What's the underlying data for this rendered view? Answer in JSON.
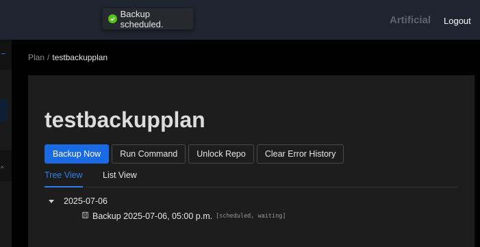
{
  "toast": {
    "icon": "check-circle-icon",
    "message": "Backup scheduled."
  },
  "topbar": {
    "brand": "Artificial",
    "logout_label": "Logout"
  },
  "breadcrumb": {
    "parent": "Plan",
    "separator": "/",
    "current": "testbackupplan"
  },
  "page": {
    "title": "testbackupplan"
  },
  "actions": {
    "backup_now": "Backup Now",
    "run_command": "Run Command",
    "unlock_repo": "Unlock Repo",
    "clear_error_history": "Clear Error History"
  },
  "tabs": [
    {
      "label": "Tree View",
      "active": true
    },
    {
      "label": "List View",
      "active": false
    }
  ],
  "tree": {
    "date": "2025-07-06",
    "items": [
      {
        "icon": "disk-icon",
        "label": "Backup 2025-07-06, 05:00 p.m.",
        "status": "[scheduled, waiting]"
      }
    ]
  },
  "colors": {
    "primary": "#1a6ae3",
    "topbar_bg": "#1f2530",
    "success": "#52c41a"
  }
}
